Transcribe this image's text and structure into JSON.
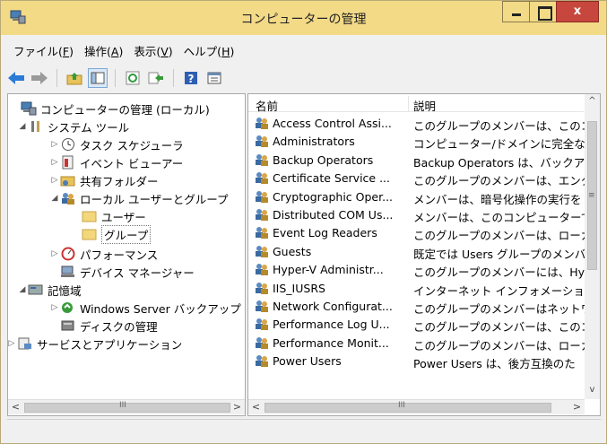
{
  "window": {
    "title": "コンピューターの管理",
    "close_glyph": "x"
  },
  "menu": [
    {
      "label": "ファイル(",
      "key": "F",
      "tail": ")"
    },
    {
      "label": "操作(",
      "key": "A",
      "tail": ")"
    },
    {
      "label": "表示(",
      "key": "V",
      "tail": ")"
    },
    {
      "label": "ヘルプ(",
      "key": "H",
      "tail": ")"
    }
  ],
  "toolbar": {
    "icons": [
      "back-arrow-icon",
      "forward-arrow-icon",
      "up-folder-icon",
      "show-hide-console-tree-icon",
      "refresh-icon",
      "export-list-icon",
      "help-icon",
      "properties-icon"
    ]
  },
  "tree": {
    "root": "コンピューターの管理 (ローカル)",
    "system_tools": "システム ツール",
    "task_scheduler": "タスク スケジューラ",
    "event_viewer": "イベント ビューアー",
    "shared_folders": "共有フォルダー",
    "local_users_groups": "ローカル ユーザーとグループ",
    "users": "ユーザー",
    "groups": "グループ",
    "performance": "パフォーマンス",
    "device_manager": "デバイス マネージャー",
    "storage": "記憶域",
    "windows_server_backup": "Windows Server バックアップ",
    "disk_management": "ディスクの管理",
    "services_apps": "サービスとアプリケーション"
  },
  "list": {
    "col_name": "名前",
    "col_desc": "説明",
    "rows": [
      {
        "name": "Access Control Assi...",
        "desc": "このグループのメンバーは、このコン"
      },
      {
        "name": "Administrators",
        "desc": "コンピューター/ドメインに完全なアク"
      },
      {
        "name": "Backup Operators",
        "desc": "Backup Operators は、バックア"
      },
      {
        "name": "Certificate Service ...",
        "desc": "このグループのメンバーは、エンター"
      },
      {
        "name": "Cryptographic Oper...",
        "desc": "メンバーは、暗号化操作の実行を"
      },
      {
        "name": "Distributed COM Us...",
        "desc": "メンバーは、このコンピューターで分"
      },
      {
        "name": "Event Log Readers",
        "desc": "このグループのメンバーは、ローカル"
      },
      {
        "name": "Guests",
        "desc": "既定では Users グループのメンバ"
      },
      {
        "name": "Hyper-V Administr...",
        "desc": "このグループのメンバーには、Hype"
      },
      {
        "name": "IIS_IUSRS",
        "desc": "インターネット インフォメーション サ"
      },
      {
        "name": "Network Configurat...",
        "desc": "このグループのメンバーはネットワー"
      },
      {
        "name": "Performance Log U...",
        "desc": "このグループのメンバーは、このコン"
      },
      {
        "name": "Performance Monit...",
        "desc": "このグループのメンバーは、ローカル"
      },
      {
        "name": "Power Users",
        "desc": "Power Users は、後方互換のた"
      }
    ]
  },
  "scroll": {
    "left": "<",
    "right": ">",
    "grip": "III",
    "up": "^",
    "down": "v",
    "vgrip": "≡"
  }
}
